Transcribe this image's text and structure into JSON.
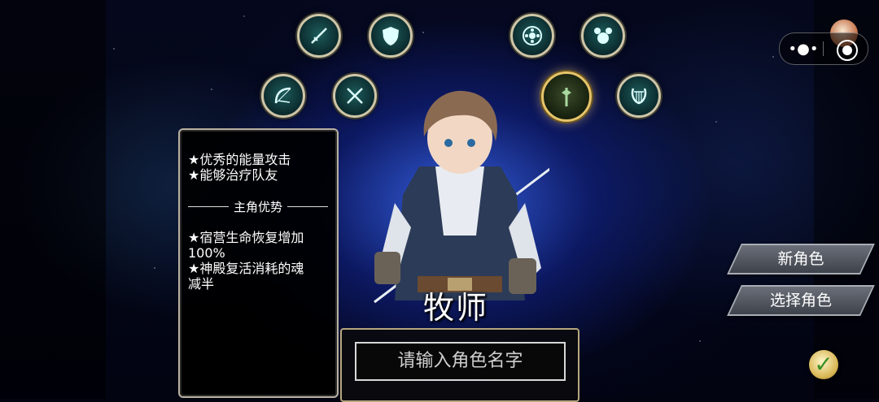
{
  "class_icons": [
    {
      "name": "swordsman-class-icon",
      "icon": "sword"
    },
    {
      "name": "guardian-class-icon",
      "icon": "shield"
    },
    {
      "name": "archer-class-icon",
      "icon": "bow"
    },
    {
      "name": "assassin-class-icon",
      "icon": "crossed-blades"
    },
    {
      "name": "mage-class-icon",
      "icon": "flower-circle"
    },
    {
      "name": "summoner-class-icon",
      "icon": "orbs"
    },
    {
      "name": "priest-class-icon",
      "icon": "staff",
      "selected": true
    },
    {
      "name": "bard-class-icon",
      "icon": "lyre"
    }
  ],
  "description": {
    "traits": [
      "★优秀的能量攻击",
      "★能够治疗队友"
    ],
    "section_title": "主角优势",
    "advantages": [
      "★宿营生命恢复增加",
      "100%",
      "★神殿复活消耗的魂",
      "减半"
    ]
  },
  "character": {
    "class_name": "牧师"
  },
  "name_input": {
    "placeholder": "请输入角色名字"
  },
  "menu": {
    "new_character": "新角色",
    "select_character": "选择角色"
  },
  "capsule": {
    "more_label": "•●•"
  },
  "colors": {
    "accent_gold": "#e6c46a",
    "icon_border": "#cfc6a8",
    "check_green": "#3b8e26"
  }
}
